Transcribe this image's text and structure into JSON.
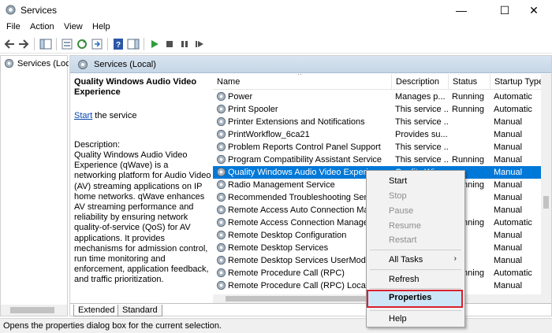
{
  "window": {
    "title": "Services",
    "minimize": "—",
    "maximize": "☐",
    "close": "✕"
  },
  "menubar": {
    "items": [
      "File",
      "Action",
      "View",
      "Help"
    ]
  },
  "tree": {
    "root": "Services (Local)"
  },
  "pane": {
    "header": "Services (Local)"
  },
  "description": {
    "title": "Quality Windows Audio Video Experience",
    "start_link": "Start",
    "start_suffix": " the service",
    "label": "Description:",
    "text": "Quality Windows Audio Video Experience (qWave) is a networking platform for Audio Video (AV) streaming applications on IP home networks. qWave enhances AV streaming performance and reliability by ensuring network quality-of-service (QoS) for AV applications. It provides mechanisms for admission control, run time monitoring and enforcement, application feedback, and traffic prioritization."
  },
  "columns": {
    "name": "Name",
    "description": "Description",
    "status": "Status",
    "startup": "Startup Type"
  },
  "services": [
    {
      "name": "Power",
      "description": "Manages p...",
      "status": "Running",
      "startup": "Automatic"
    },
    {
      "name": "Print Spooler",
      "description": "This service ...",
      "status": "Running",
      "startup": "Automatic"
    },
    {
      "name": "Printer Extensions and Notifications",
      "description": "This service ...",
      "status": "",
      "startup": "Manual"
    },
    {
      "name": "PrintWorkflow_6ca21",
      "description": "Provides su...",
      "status": "",
      "startup": "Manual"
    },
    {
      "name": "Problem Reports Control Panel Support",
      "description": "This service ...",
      "status": "",
      "startup": "Manual"
    },
    {
      "name": "Program Compatibility Assistant Service",
      "description": "This service ...",
      "status": "Running",
      "startup": "Manual"
    },
    {
      "name": "Quality Windows Audio Video Experience",
      "description": "Quality Win...",
      "status": "",
      "startup": "Manual"
    },
    {
      "name": "Radio Management Service",
      "description": "",
      "status": "Running",
      "startup": "Manual"
    },
    {
      "name": "Recommended Troubleshooting Service",
      "description": "",
      "status": "",
      "startup": "Manual"
    },
    {
      "name": "Remote Access Auto Connection Manager",
      "description": "",
      "status": "",
      "startup": "Manual"
    },
    {
      "name": "Remote Access Connection Manager",
      "description": "",
      "status": "Running",
      "startup": "Automatic"
    },
    {
      "name": "Remote Desktop Configuration",
      "description": "",
      "status": "",
      "startup": "Manual"
    },
    {
      "name": "Remote Desktop Services",
      "description": "",
      "status": "",
      "startup": "Manual"
    },
    {
      "name": "Remote Desktop Services UserMode Port Redirector",
      "description": "",
      "status": "",
      "startup": "Manual"
    },
    {
      "name": "Remote Procedure Call (RPC)",
      "description": "",
      "status": "Running",
      "startup": "Automatic"
    },
    {
      "name": "Remote Procedure Call (RPC) Locator",
      "description": "",
      "status": "",
      "startup": "Manual"
    }
  ],
  "tabs": [
    "Extended",
    "Standard"
  ],
  "status_bar": "Opens the properties dialog box for the current selection.",
  "context_menu": {
    "start": "Start",
    "stop": "Stop",
    "pause": "Pause",
    "resume": "Resume",
    "restart": "Restart",
    "all_tasks": "All Tasks",
    "all_tasks_arrow": "›",
    "refresh": "Refresh",
    "properties": "Properties",
    "help": "Help"
  },
  "colors": {
    "selection": "#0078d7",
    "highlight_border": "#d9202e",
    "link": "#0645ad"
  }
}
